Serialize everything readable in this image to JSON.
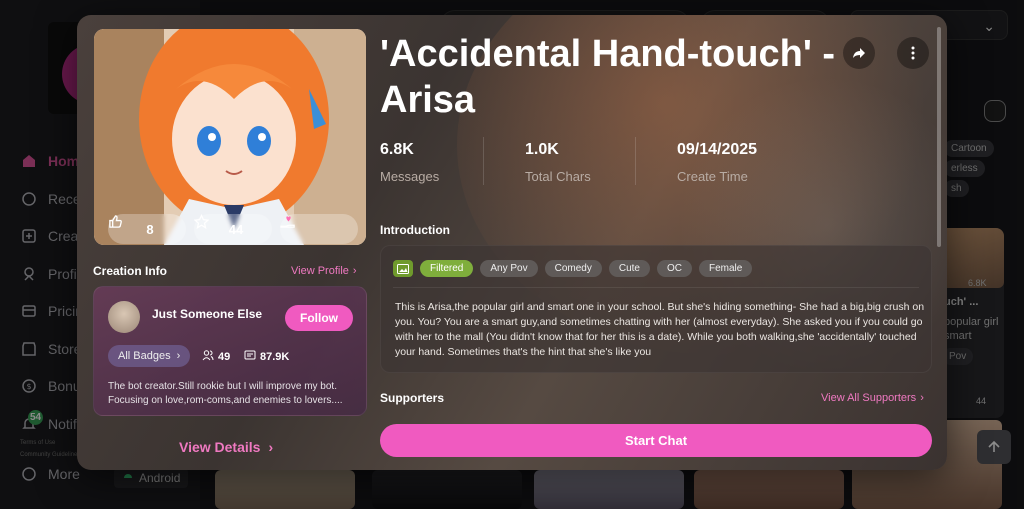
{
  "sidebar": {
    "items": [
      {
        "label": "Home",
        "icon": "home-icon"
      },
      {
        "label": "Recent",
        "icon": "chat-icon"
      },
      {
        "label": "Create",
        "icon": "plus-square-icon"
      },
      {
        "label": "Profile",
        "icon": "profile-icon"
      },
      {
        "label": "Pricing",
        "icon": "card-icon"
      },
      {
        "label": "Store",
        "icon": "store-icon"
      },
      {
        "label": "Bonus",
        "icon": "coin-icon"
      },
      {
        "label": "Notifications",
        "icon": "bell-icon"
      },
      {
        "label": "More",
        "icon": "more-icon"
      }
    ],
    "notification_count": "54",
    "footer_links": [
      "Terms of Use",
      "Community Guidelines"
    ],
    "android_label": "Android"
  },
  "background": {
    "tags": [
      "Cartoon",
      "erless",
      "sh"
    ],
    "card_stat": "6.8K",
    "card_title": "uch' ...",
    "card_desc_1": "popular girl",
    "card_desc_2": "smart",
    "card_tag_1": "Pov",
    "card_likes": "44"
  },
  "modal": {
    "title": "'Accidental Hand-touch' - Arisa",
    "likes": "8",
    "favorites": "44",
    "stats": [
      {
        "value": "6.8K",
        "label": "Messages"
      },
      {
        "value": "1.0K",
        "label": "Total Chars"
      },
      {
        "value": "09/14/2025",
        "label": "Create Time"
      }
    ],
    "creation_info_title": "Creation Info",
    "view_profile_label": "View Profile",
    "creator": {
      "name": "Just Someone Else",
      "follow_label": "Follow",
      "badges_label": "All Badges",
      "followers": "49",
      "chars": "87.9K",
      "bio": "The bot creator.Still rookie but I will improve my bot. Focusing on love,rom-coms,and enemies to lovers...."
    },
    "view_details_label": "View Details",
    "introduction_title": "Introduction",
    "tags": [
      "Filtered",
      "Any Pov",
      "Comedy",
      "Cute",
      "OC",
      "Female"
    ],
    "introduction_text": "This is Arisa,the popular girl and smart one in your school. But she's hiding something- She had a big,big crush on you. You? You are a smart guy,and sometimes chatting with her (almost everyday). She asked you if you could go with her to the mall (You didn't know that for her this is a date). While you both walking,she 'accidentally' touched your hand. Sometimes that's the hint that she's like you",
    "supporters_title": "Supporters",
    "view_all_supporters_label": "View All Supporters",
    "start_chat_label": "Start Chat"
  },
  "colors": {
    "accent": "#f05ac0",
    "accent_text": "#ef79c1",
    "filtered_tag": "#7fae3c"
  }
}
